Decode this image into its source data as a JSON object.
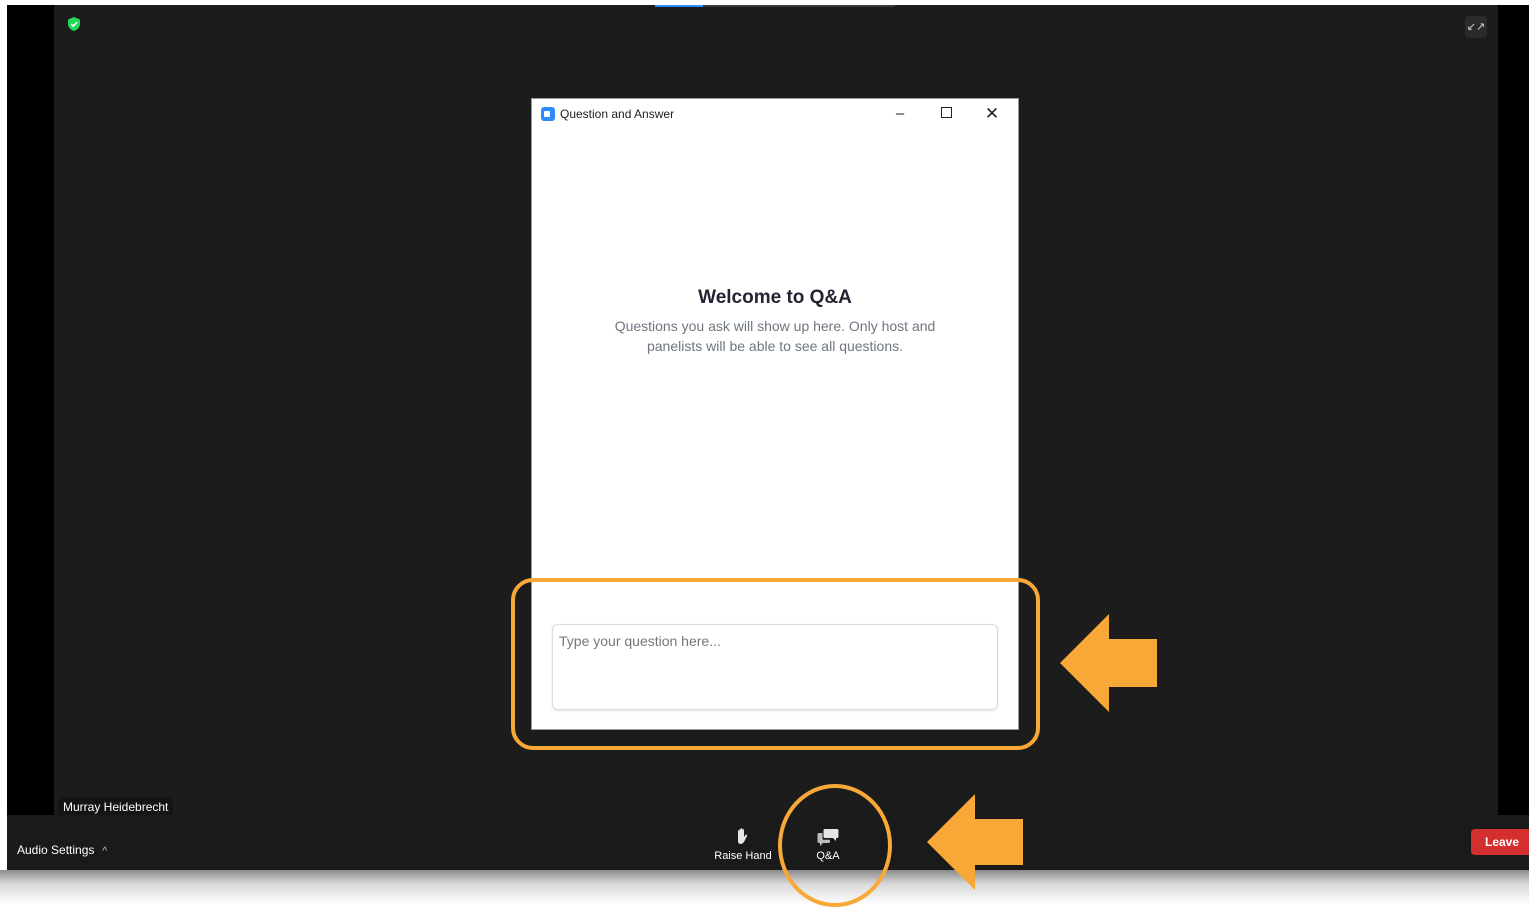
{
  "meeting": {
    "participant_name": "Murray Heidebrecht",
    "exit_fullscreen_icon": "exit-fullscreen-icon",
    "security_icon": "shield-check-icon"
  },
  "qa_window": {
    "title": "Question and Answer",
    "welcome_title": "Welcome to Q&A",
    "welcome_description": "Questions you ask will show up here. Only host and panelists will be able to see all questions.",
    "input_placeholder": "Type your question here...",
    "input_value": ""
  },
  "toolbar": {
    "audio_settings_label": "Audio Settings",
    "raise_hand_label": "Raise Hand",
    "qa_label": "Q&A",
    "leave_label": "Leave"
  },
  "colors": {
    "annotation": "#f7a836",
    "leave": "#d32f2f",
    "zoom_blue": "#2d8cff",
    "security_green": "#23d959"
  }
}
